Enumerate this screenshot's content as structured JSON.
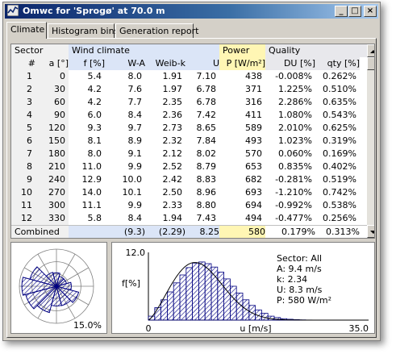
{
  "window": {
    "title": "Omwc for  'Sprogø' at 70.0 m"
  },
  "tabs": [
    {
      "label": "Climate",
      "active": true
    },
    {
      "label": "Histogram bins",
      "active": false
    },
    {
      "label": "Generation report",
      "active": false
    }
  ],
  "table": {
    "groups": {
      "sector": "Sector",
      "wind": "Wind climate",
      "power": "Power",
      "quality": "Quality"
    },
    "columns": {
      "num": "#",
      "a": "a [°]",
      "f": "f [%]",
      "wa": "W-A",
      "weibk": "Weib-k",
      "u": "U",
      "p": "P [W/m²]",
      "du": "DU [%]",
      "qty": "qty [%]"
    },
    "rows": [
      [
        "1",
        "0",
        "5.4",
        "8.0",
        "1.91",
        "7.10",
        "438",
        "-0.008%",
        "0.262%"
      ],
      [
        "2",
        "30",
        "4.2",
        "7.6",
        "1.97",
        "6.78",
        "371",
        "1.225%",
        "0.510%"
      ],
      [
        "3",
        "60",
        "4.2",
        "7.7",
        "2.35",
        "6.78",
        "316",
        "2.286%",
        "0.635%"
      ],
      [
        "4",
        "90",
        "6.0",
        "8.4",
        "2.36",
        "7.42",
        "411",
        "1.080%",
        "0.543%"
      ],
      [
        "5",
        "120",
        "9.3",
        "9.7",
        "2.73",
        "8.65",
        "589",
        "2.010%",
        "0.625%"
      ],
      [
        "6",
        "150",
        "8.1",
        "8.9",
        "2.32",
        "7.84",
        "493",
        "1.023%",
        "0.319%"
      ],
      [
        "7",
        "180",
        "8.0",
        "9.1",
        "2.12",
        "8.02",
        "570",
        "0.060%",
        "0.169%"
      ],
      [
        "8",
        "210",
        "11.0",
        "9.9",
        "2.52",
        "8.79",
        "653",
        "0.835%",
        "0.402%"
      ],
      [
        "9",
        "240",
        "12.9",
        "10.0",
        "2.42",
        "8.83",
        "682",
        "-0.281%",
        "0.519%"
      ],
      [
        "10",
        "270",
        "14.0",
        "10.1",
        "2.50",
        "8.96",
        "693",
        "-1.210%",
        "0.742%"
      ],
      [
        "11",
        "300",
        "11.1",
        "9.9",
        "2.33",
        "8.80",
        "694",
        "-0.992%",
        "0.538%"
      ],
      [
        "12",
        "330",
        "5.8",
        "8.4",
        "1.94",
        "7.43",
        "494",
        "-0.477%",
        "0.256%"
      ]
    ],
    "combined": {
      "label": "Combined",
      "wa": "(9.3)",
      "weibk": "(2.29)",
      "u": "8.25",
      "p": "580",
      "du": "0.179%",
      "qty": "0.313%"
    }
  },
  "rose": {
    "scale_label": "15.0%",
    "frequencies": [
      5.4,
      4.2,
      4.2,
      6.0,
      9.3,
      8.1,
      8.0,
      11.0,
      12.9,
      14.0,
      11.1,
      5.8
    ],
    "max": 15.0
  },
  "histogram": {
    "y_max_label": "12.0",
    "y_label": "f[%]",
    "x_min_label": "0",
    "x_max_label": "35.0",
    "x_label": "u [m/s]",
    "sector_line": "Sector: All",
    "a_line": "A: 9.4 m/s",
    "k_line": "k: 2.34",
    "u_line": "U: 8.3 m/s",
    "p_line": "P: 580 W/m²"
  },
  "chart_data": {
    "type": "bar",
    "title": "",
    "xlabel": "u [m/s]",
    "ylabel": "f[%]",
    "xlim": [
      0,
      35
    ],
    "ylim": [
      0,
      12
    ],
    "x": [
      0.5,
      1.5,
      2.5,
      3.5,
      4.5,
      5.5,
      6.5,
      7.5,
      8.5,
      9.5,
      10.5,
      11.5,
      12.5,
      13.5,
      14.5,
      15.5,
      16.5,
      17.5,
      18.5,
      19.5,
      20.5,
      21.5,
      22.5,
      23.5,
      24.5,
      25.5
    ],
    "values": [
      0.7,
      2.2,
      3.6,
      5.0,
      6.6,
      8.0,
      9.3,
      10.1,
      10.3,
      10.0,
      9.4,
      8.5,
      7.3,
      6.0,
      4.8,
      3.6,
      2.6,
      1.8,
      1.2,
      0.7,
      0.45,
      0.25,
      0.15,
      0.08,
      0.04,
      0.02
    ],
    "fit": {
      "weibull_A": 9.4,
      "weibull_k": 2.34
    }
  }
}
